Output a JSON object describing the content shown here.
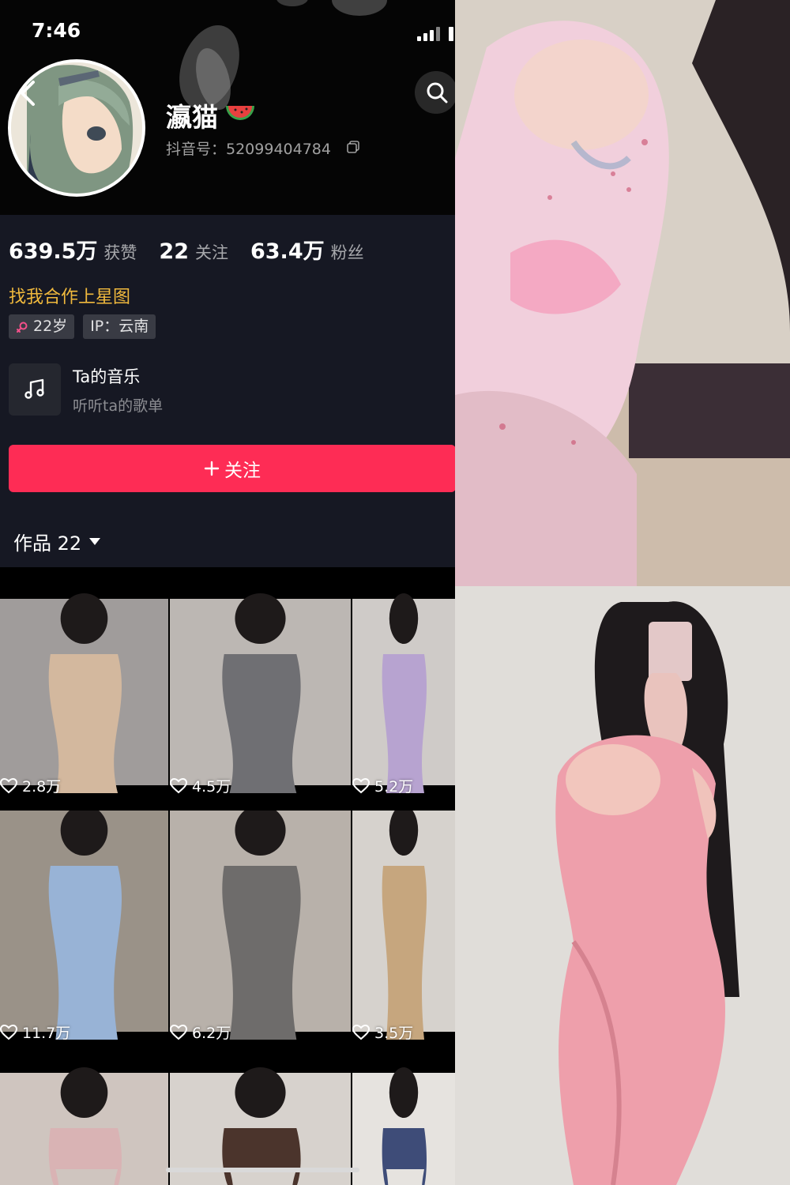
{
  "status_bar": {
    "time": "7:46",
    "battery_partial": "4"
  },
  "profile": {
    "name": "瀛猫",
    "douyin_id": "抖音号：52099404784",
    "stats": [
      {
        "value": "639.5万",
        "label": "获赞"
      },
      {
        "value": "22",
        "label": "关注"
      },
      {
        "value": "63.4万",
        "label": "粉丝"
      }
    ],
    "bio": "找我合作上星图",
    "tags": {
      "age": "22岁",
      "ip": "IP：云南"
    },
    "music": {
      "title": "Ta的音乐",
      "subtitle": "听听ta的歌单"
    },
    "follow_label": "关注"
  },
  "works": {
    "tab_label": "作品 22",
    "items": [
      {
        "likes": "2.8万",
        "bg": "#a09c9b",
        "fg": "#d3b89e"
      },
      {
        "likes": "4.5万",
        "bg": "#bcb7b3",
        "fg": "#6f6f73"
      },
      {
        "likes": "5.2万",
        "bg": "#cfcbc8",
        "fg": "#b7a3d0"
      },
      {
        "likes": "11.7万",
        "bg": "#9a9288",
        "fg": "#98b3d6"
      },
      {
        "likes": "6.2万",
        "bg": "#b8b1aa",
        "fg": "#6e6c6b"
      },
      {
        "likes": "3.5万",
        "bg": "#d6d2cd",
        "fg": "#c6a67e"
      },
      {
        "likes": "",
        "bg": "#cfc5bf",
        "fg": "#d9b3b4"
      },
      {
        "likes": "",
        "bg": "#d7d2cd",
        "fg": "#4b342c"
      },
      {
        "likes": "",
        "bg": "#e6e3df",
        "fg": "#3e4c78"
      }
    ]
  },
  "colors": {
    "accent": "#fe2c55",
    "bio": "#f0b93d",
    "background": "#161823"
  }
}
